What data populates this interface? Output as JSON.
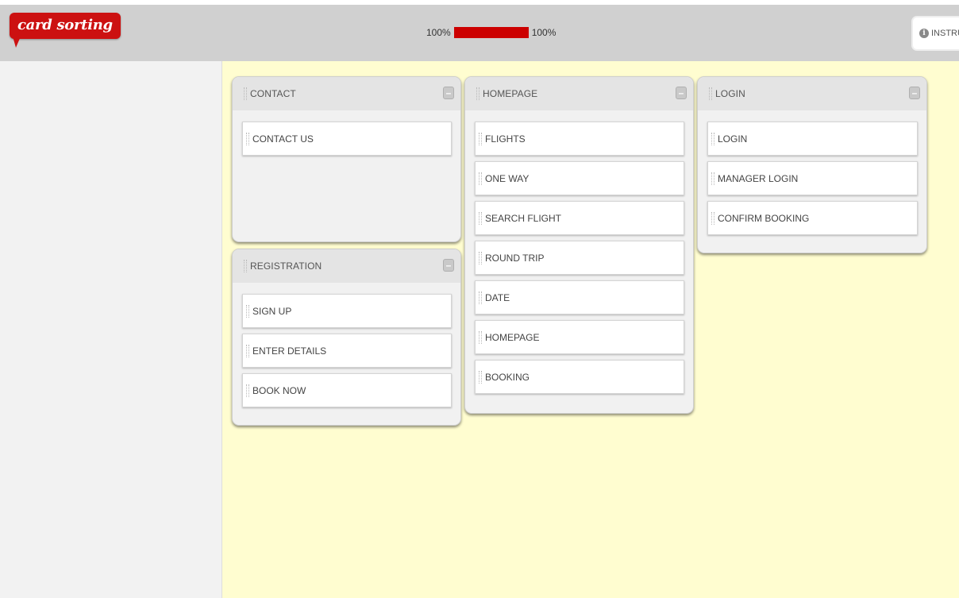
{
  "header": {
    "logo_text": "card sorting",
    "progress": {
      "left_label": "100%",
      "right_label": "100%",
      "fraction": 1.0,
      "color": "#cc0000"
    },
    "instructions_label": "INSTRU"
  },
  "groups": [
    {
      "title": "CONTACT",
      "cards": [
        "CONTACT US"
      ]
    },
    {
      "title": "REGISTRATION",
      "cards": [
        "SIGN UP",
        "ENTER DETAILS",
        "BOOK NOW"
      ]
    },
    {
      "title": "HOMEPAGE",
      "cards": [
        "FLIGHTS",
        "ONE WAY",
        "SEARCH FLIGHT",
        "ROUND TRIP",
        "DATE",
        "HOMEPAGE",
        "BOOKING"
      ]
    },
    {
      "title": "LOGIN",
      "cards": [
        "LOGIN",
        "MANAGER LOGIN",
        "CONFIRM BOOKING"
      ]
    }
  ],
  "colors": {
    "brand": "#cc1111",
    "board": "#fffdd0",
    "sidebar": "#f2f2f2",
    "header": "#d0d0d0"
  }
}
